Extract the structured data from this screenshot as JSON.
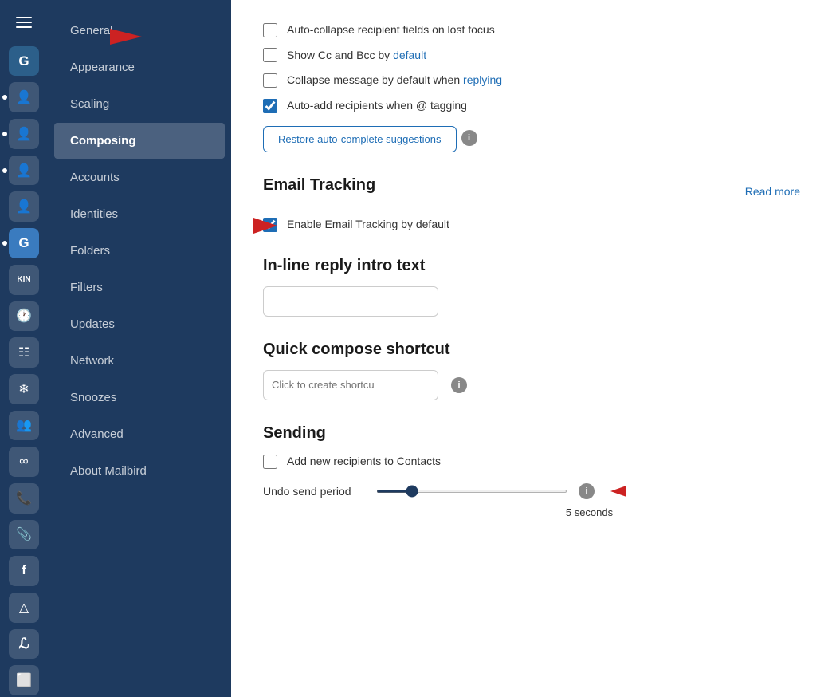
{
  "sidebar": {
    "items": [
      {
        "id": "general",
        "label": "General",
        "active": false
      },
      {
        "id": "appearance",
        "label": "Appearance",
        "active": false
      },
      {
        "id": "scaling",
        "label": "Scaling",
        "active": false
      },
      {
        "id": "composing",
        "label": "Composing",
        "active": true
      },
      {
        "id": "accounts",
        "label": "Accounts",
        "active": false
      },
      {
        "id": "identities",
        "label": "Identities",
        "active": false
      },
      {
        "id": "folders",
        "label": "Folders",
        "active": false
      },
      {
        "id": "filters",
        "label": "Filters",
        "active": false
      },
      {
        "id": "updates",
        "label": "Updates",
        "active": false
      },
      {
        "id": "network",
        "label": "Network",
        "active": false
      },
      {
        "id": "snoozes",
        "label": "Snoozes",
        "active": false
      },
      {
        "id": "advanced",
        "label": "Advanced",
        "active": false
      },
      {
        "id": "about",
        "label": "About Mailbird",
        "active": false
      }
    ]
  },
  "composing": {
    "checkboxes": [
      {
        "id": "auto-collapse",
        "label": "Auto-collapse recipient fields on lost focus",
        "checked": false
      },
      {
        "id": "show-cc-bcc",
        "label_pre": "Show Cc and Bcc by ",
        "label_link": "default",
        "checked": false
      },
      {
        "id": "collapse-message",
        "label_pre": "Collapse message by default when replying",
        "label_link": "",
        "label_blue": "replying",
        "checked": false,
        "full_label": "Collapse message by default when replying"
      },
      {
        "id": "auto-add",
        "label": "Auto-add recipients when @ tagging",
        "checked": true
      }
    ],
    "restore_btn_label": "Restore auto-complete suggestions",
    "email_tracking": {
      "title": "Email Tracking",
      "checkbox_label": "Enable Email Tracking by default",
      "checkbox_checked": true,
      "read_more": "Read more"
    },
    "inline_reply": {
      "title": "In-line reply intro text",
      "placeholder": ""
    },
    "quick_compose": {
      "title": "Quick compose shortcut",
      "placeholder": "Click to create shortcu"
    },
    "sending": {
      "title": "Sending",
      "add_recipients_label": "Add new recipients to Contacts",
      "add_recipients_checked": false,
      "undo_label": "Undo send period",
      "undo_value": 5,
      "undo_min": 0,
      "undo_max": 30,
      "undo_display": "5 seconds"
    }
  }
}
